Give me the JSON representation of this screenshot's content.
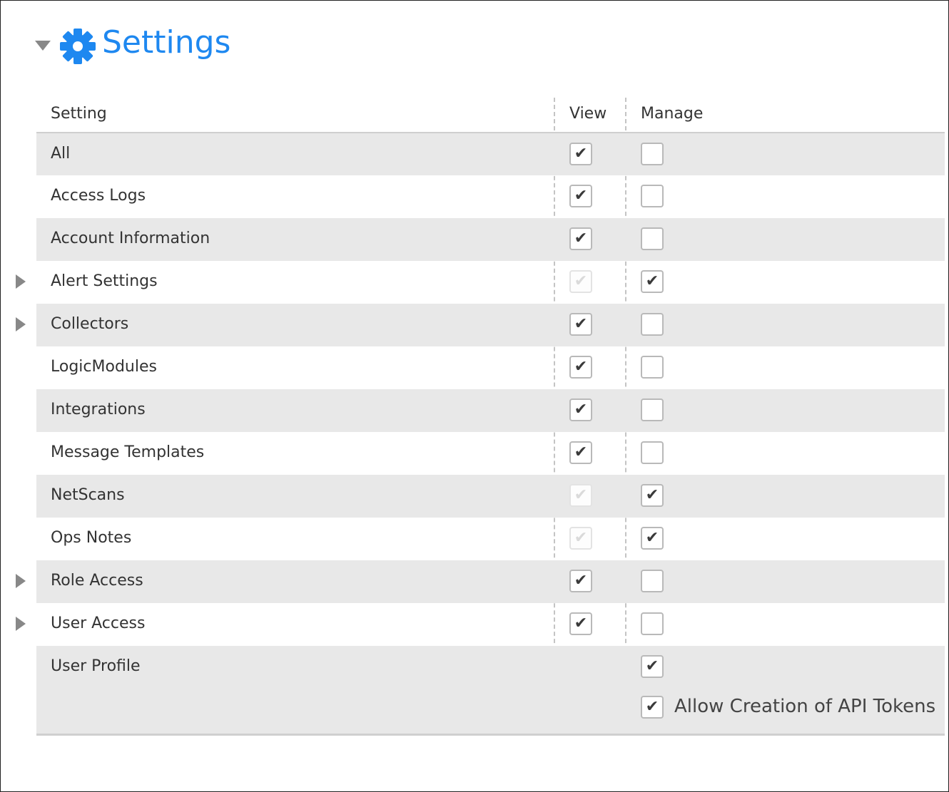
{
  "header": {
    "title": "Settings",
    "icon": "gear-icon",
    "accent_color": "#1e88f0",
    "expanded": true
  },
  "columns": {
    "setting": "Setting",
    "view": "View",
    "manage": "Manage"
  },
  "rows": [
    {
      "label": "All",
      "expandable": false,
      "view": "checked",
      "manage": "unchecked"
    },
    {
      "label": "Access Logs",
      "expandable": false,
      "view": "checked",
      "manage": "unchecked"
    },
    {
      "label": "Account Information",
      "expandable": false,
      "view": "checked",
      "manage": "unchecked"
    },
    {
      "label": "Alert Settings",
      "expandable": true,
      "view": "disabled-checked",
      "manage": "checked"
    },
    {
      "label": "Collectors",
      "expandable": true,
      "view": "checked",
      "manage": "unchecked"
    },
    {
      "label": "LogicModules",
      "expandable": false,
      "view": "checked",
      "manage": "unchecked"
    },
    {
      "label": "Integrations",
      "expandable": false,
      "view": "checked",
      "manage": "unchecked"
    },
    {
      "label": "Message Templates",
      "expandable": false,
      "view": "checked",
      "manage": "unchecked"
    },
    {
      "label": "NetScans",
      "expandable": false,
      "view": "disabled-checked",
      "manage": "checked"
    },
    {
      "label": "Ops Notes",
      "expandable": false,
      "view": "disabled-checked",
      "manage": "checked"
    },
    {
      "label": "Role Access",
      "expandable": true,
      "view": "checked",
      "manage": "unchecked"
    },
    {
      "label": "User Access",
      "expandable": true,
      "view": "checked",
      "manage": "unchecked"
    },
    {
      "label": "User Profile",
      "expandable": false,
      "view": "none",
      "manage": "checked",
      "extra_option": {
        "label": "Allow Creation of API Tokens",
        "state": "checked"
      }
    }
  ]
}
